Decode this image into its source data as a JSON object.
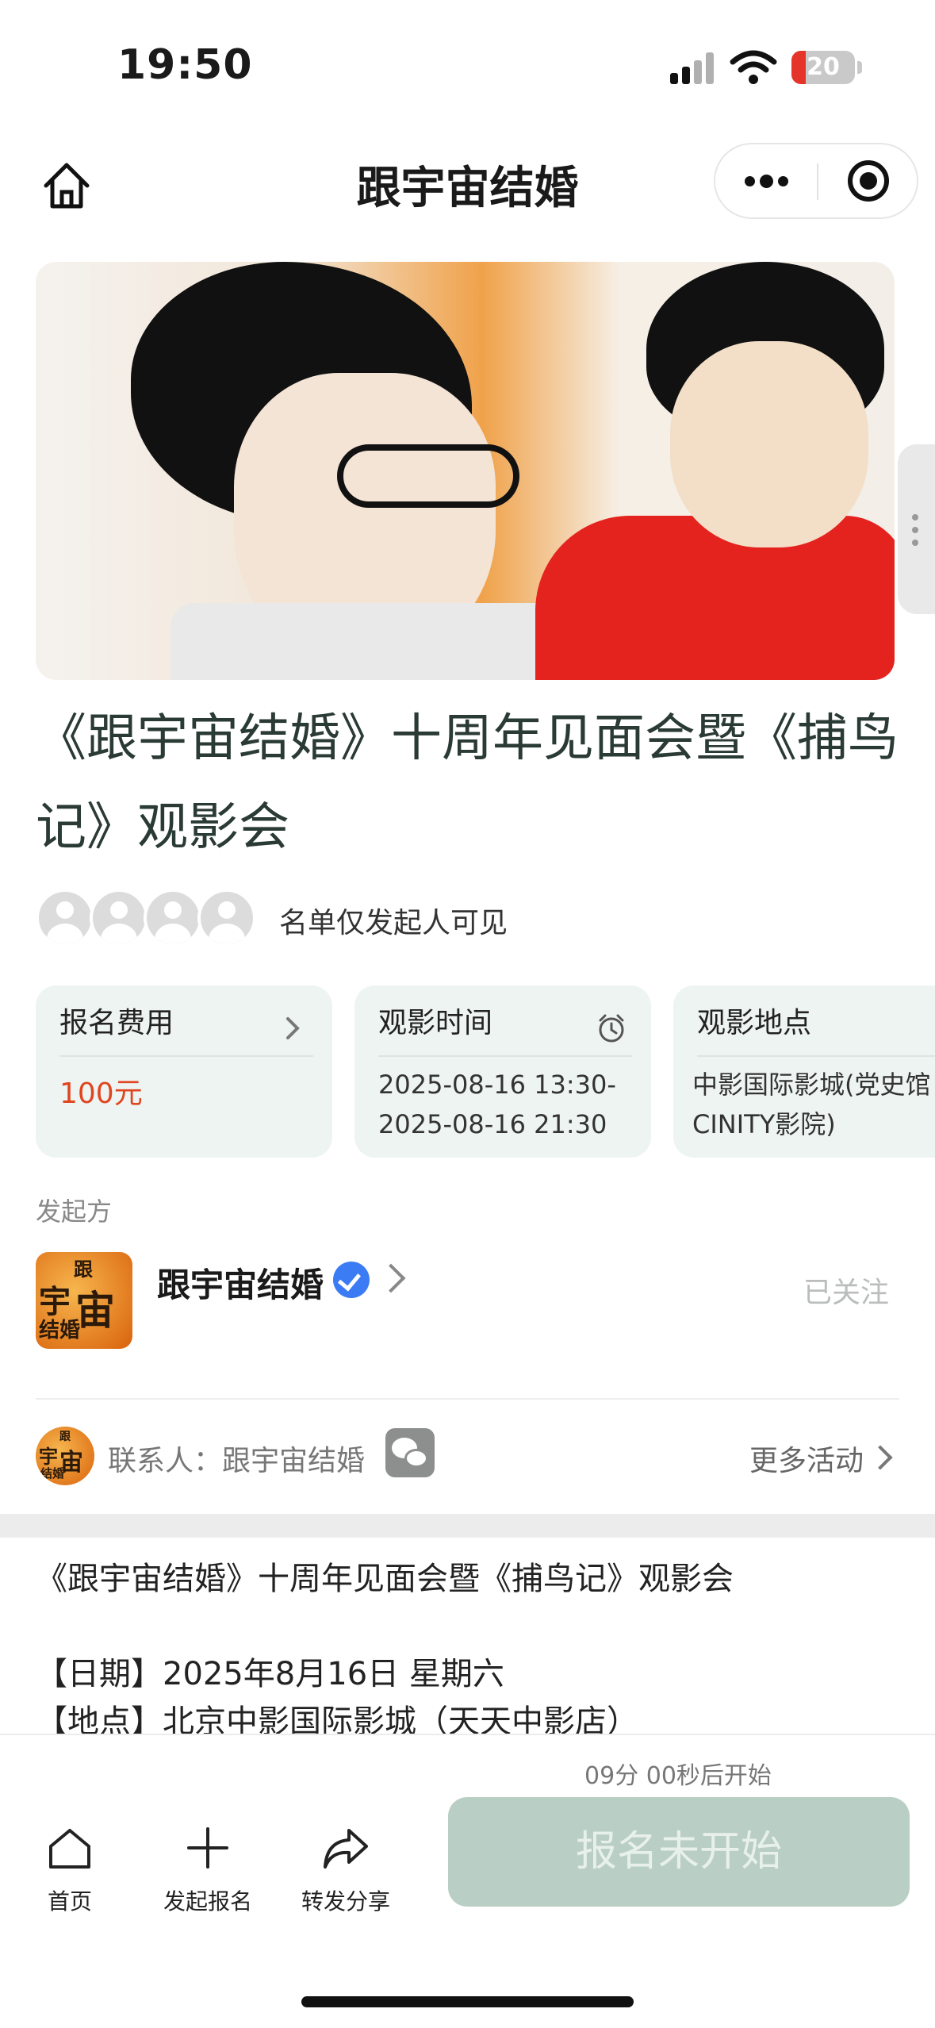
{
  "status": {
    "time": "19:50",
    "battery": "20"
  },
  "nav": {
    "title": "跟宇宙结婚"
  },
  "event": {
    "title": "《跟宇宙结婚》十周年见面会暨《捕鸟记》观影会",
    "attendees_note": "名单仅发起人可见"
  },
  "cards": [
    {
      "label": "报名费用",
      "icon": "chevron-right-icon",
      "value": "100元"
    },
    {
      "label": "观影时间",
      "icon": "alarm-clock-icon",
      "value_line1": "2025-08-16 13:30-",
      "value_line2": "2025-08-16 21:30"
    },
    {
      "label": "观影地点",
      "value_line1": "中影国际影城(党史馆",
      "value_line2": "CINITY影院)"
    }
  ],
  "organizer": {
    "section_label": "发起方",
    "name": "跟宇宙结婚",
    "follow_status": "已关注",
    "logo_chars": [
      "跟",
      "宇",
      "宙",
      "结婚"
    ]
  },
  "contact": {
    "text": "联系人：跟宇宙结婚",
    "more_label": "更多活动"
  },
  "description": {
    "line1": "《跟宇宙结婚》十周年见面会暨《捕鸟记》观影会",
    "line2": "【日期】2025年8月16日  星期六",
    "line3": "【地点】北京中影国际影城（天天中影店）"
  },
  "bottom": {
    "tabs": [
      {
        "label": "首页",
        "icon": "home-icon"
      },
      {
        "label": "发起报名",
        "icon": "plus-icon"
      },
      {
        "label": "转发分享",
        "icon": "share-icon"
      }
    ],
    "countdown": "09分 00秒后开始",
    "signup_label": "报名未开始"
  },
  "colors": {
    "accent": "#2a3a34",
    "fee": "#e0451f",
    "button_disabled": "#b9cec5",
    "card_bg": "#eef4f2"
  }
}
